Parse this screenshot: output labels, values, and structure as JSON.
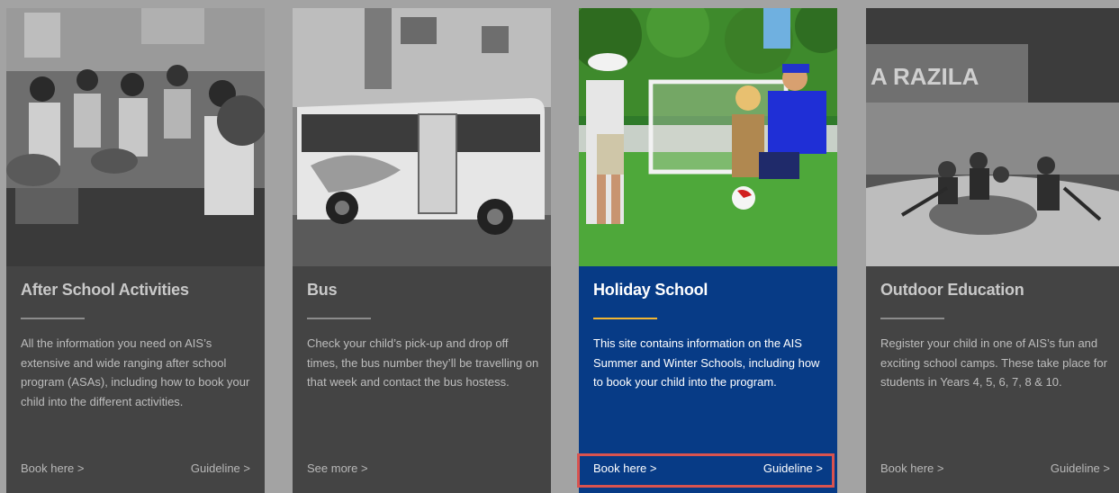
{
  "cards": [
    {
      "title": "After School Activities",
      "description": "All the information you need on AIS’s extensive and wide ranging after school program (ASAs), including how to book your child into the different activities.",
      "link_left": "Book here >",
      "link_right": "Guideline >"
    },
    {
      "title": "Bus",
      "description": "Check your child’s pick-up and drop off times, the bus number they’ll be travelling on that week and contact the bus hostess.",
      "link_left": "See more >",
      "link_right": ""
    },
    {
      "title": "Holiday School",
      "description": "This site contains information on the AIS Summer and Winter Schools, including how to book your child into the program.",
      "link_left": "Book here >",
      "link_right": "Guideline >"
    },
    {
      "title": "Outdoor Education",
      "description": "Register your child in one of AIS’s fun and exciting school camps. These take place for students in Years 4, 5, 6, 7, 8 & 10.",
      "link_left": "Book here >",
      "link_right": "Guideline >"
    }
  ],
  "photos": {
    "outdoor_banner_text": "A RAZILA"
  },
  "colors": {
    "page_background": "#a3a3a3",
    "card_background": "#444444",
    "active_card_background": "#073b86",
    "active_divider": "#f2b632",
    "highlight_border": "#d9534f"
  }
}
